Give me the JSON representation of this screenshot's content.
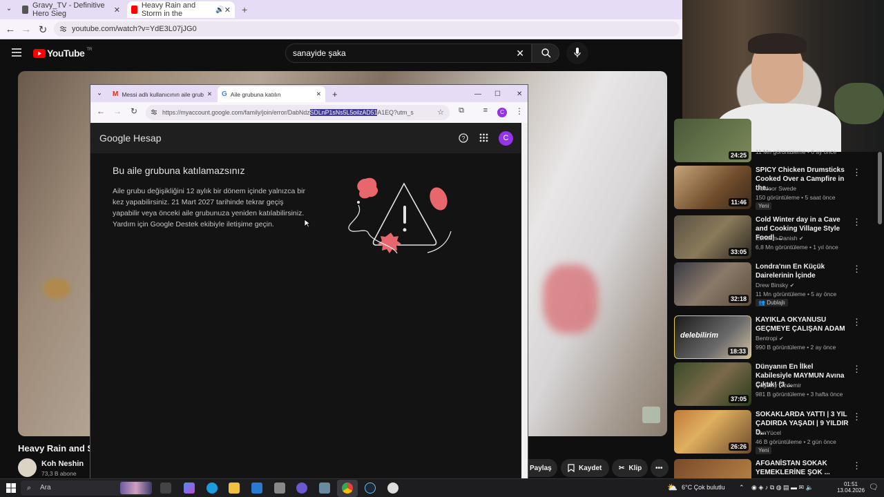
{
  "outer_browser": {
    "tabs": [
      {
        "title": "Gravy_TV - Definitive Hero Sieg"
      },
      {
        "title": "Heavy Rain and Storm in the"
      }
    ],
    "url": "youtube.com/watch?v=YdE3L07jJG0"
  },
  "youtube": {
    "logo_text": "YouTube",
    "logo_region": "TR",
    "search_value": "sanayide şaka",
    "video_title": "Heavy Rain and S",
    "channel_name": "Koh Neshin",
    "channel_subs": "73,3 B abone",
    "actions": {
      "share": "Paylaş",
      "save": "Kaydet",
      "clip": "Klip"
    }
  },
  "recommendations": [
    {
      "title": "",
      "channel": "",
      "meta": "11 Mn görüntüleme • 6 ay önce",
      "duration": "24:25",
      "badge": ""
    },
    {
      "title": "SPICY Chicken Drumsticks Cooked Over a Campfire in the...",
      "channel": "Outdoor Swede",
      "meta": "150 görüntüleme • 5 saat önce",
      "duration": "11:46",
      "badge": "Yeni"
    },
    {
      "title": "Cold Winter day in a Cave and Cooking Village Style Food| ...",
      "channel": "Ebrahim Danish",
      "meta": "6,8 Mn görüntüleme • 1 yıl önce",
      "duration": "33:05",
      "badge": ""
    },
    {
      "title": "Londra'nın En Küçük Dairelerinin İçinde",
      "channel": "Drew Binsky",
      "meta": "11 Mn görüntüleme • 5 ay önce",
      "duration": "32:18",
      "badge": "Dublajlı"
    },
    {
      "title": "KAYIKLA OKYANUSU GEÇMEYE ÇALIŞAN ADAM",
      "channel": "Bentropi",
      "meta": "990 B görüntüleme • 2 ay önce",
      "duration": "18:33",
      "badge": ""
    },
    {
      "title": "Dünyanın En İlkel Kabilesiyle MAYMUN Avına Çıktık! (3 ...",
      "channel": "Çağatay Özdemir",
      "meta": "981 B görüntüleme • 3 hafta önce",
      "duration": "37:05",
      "badge": ""
    },
    {
      "title": "SOKAKLARDA YATTI | 3 YIL ÇADIRDA YAŞADI | 9 YILDIR D...",
      "channel": "CanYücel",
      "meta": "46 B görüntüleme • 2 gün önce",
      "duration": "26:26",
      "badge": "Yeni"
    },
    {
      "title": "AFGANİSTAN SOKAK YEMEKLERİNE ŞOK ...",
      "channel": "",
      "meta": "",
      "duration": "",
      "badge": ""
    }
  ],
  "popup_browser": {
    "tabs": [
      {
        "title": "Messi adlı kullanıcının aile grub"
      },
      {
        "title": "Aile grubuna katılın"
      }
    ],
    "url_before": "https://myaccount.google.com/family/join/error/DabNdz",
    "url_selected": "SDLnP1sNs5L5oilzAD51",
    "url_after": "A1EQ?utm_s",
    "avatar_letter": "C"
  },
  "google_page": {
    "logo": "Google Hesap",
    "heading": "Bu aile grubuna katılamazsınız",
    "body": "Aile grubu değişikliğini 12 aylık bir dönem içinde yalnızca bir kez yapabilirsiniz. 21 Mart 2027 tarihinde tekrar geçiş yapabilir veya önceki aile grubunuza yeniden katılabilirsiniz. Yardım için Google Destek ekibiyle iletişime geçin."
  },
  "taskbar": {
    "search_label": "Ara",
    "weather": "6°C  Çok bulutlu",
    "time": "01:51",
    "date": "13.04.2026"
  },
  "colors": {
    "youtube_red": "#ff0000",
    "google_avatar": "#9334e6",
    "selection": "#3d3a8f",
    "chrome_tab_bar": "#e7dcf6"
  }
}
